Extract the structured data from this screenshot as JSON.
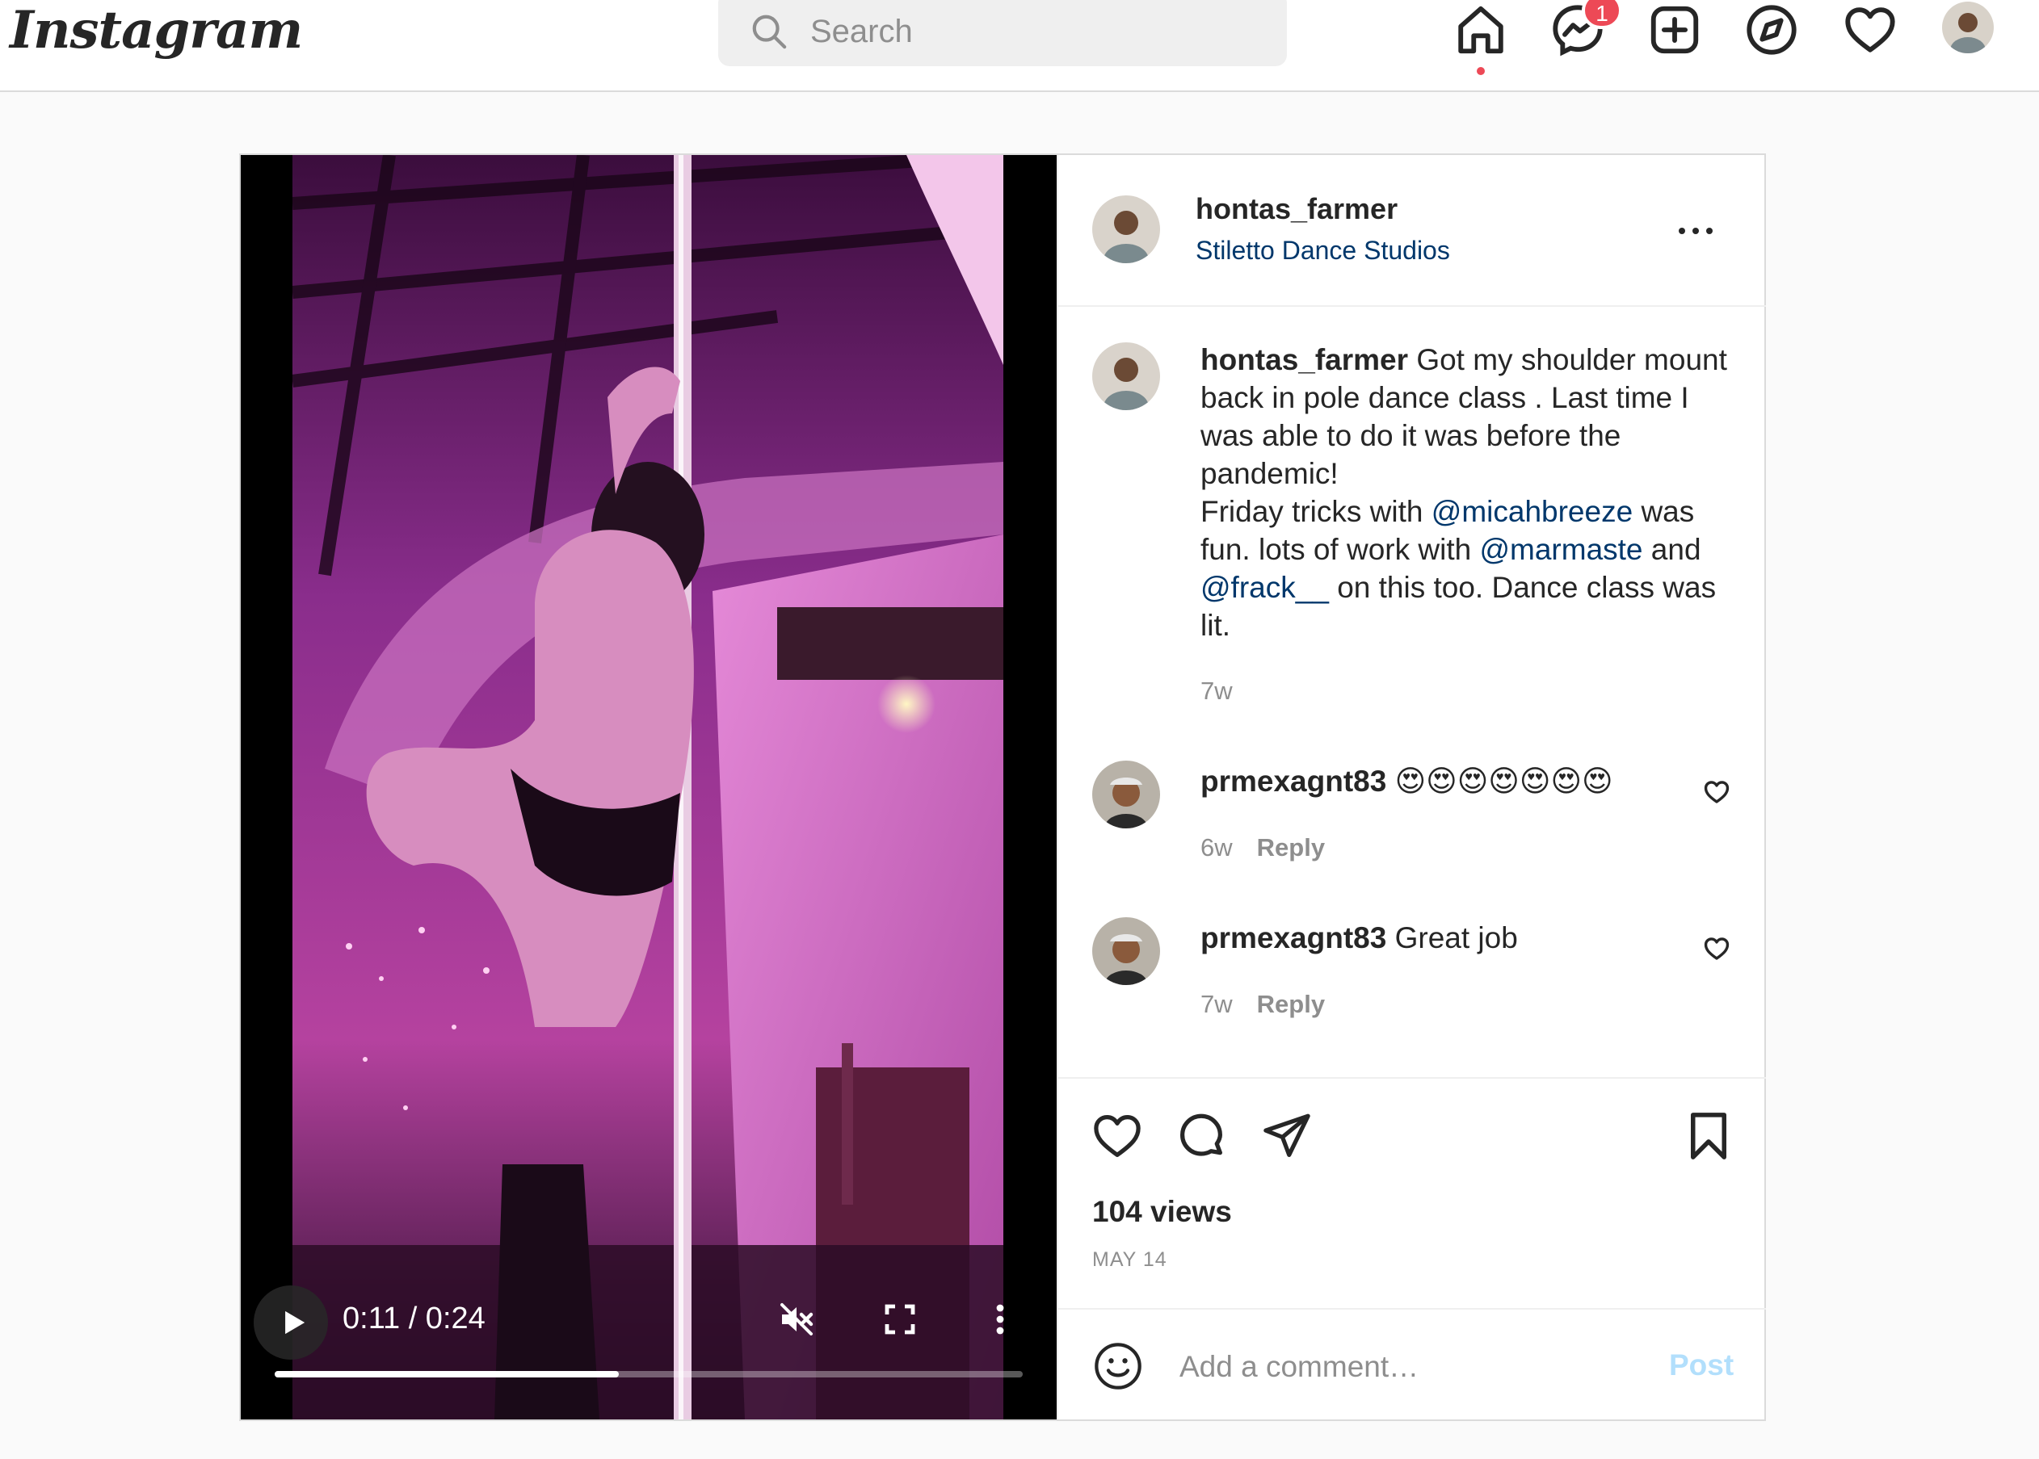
{
  "brand": {
    "logo_text": "Instagram"
  },
  "search": {
    "placeholder": "Search"
  },
  "nav": {
    "icons": [
      "home-icon",
      "messenger-icon",
      "new-post-icon",
      "explore-icon",
      "activity-heart-icon",
      "profile-avatar"
    ],
    "messenger_badge": "1",
    "active": "home",
    "accent_color": "#ed4956"
  },
  "video": {
    "time_display": "0:11 / 0:24",
    "progress_fraction": 0.46,
    "muted": true,
    "controls": [
      "play-icon",
      "mute-icon",
      "fullscreen-icon",
      "more-vert-icon"
    ]
  },
  "post": {
    "username": "hontas_farmer",
    "location": "Stiletto Dance Studios",
    "caption": {
      "username": "hontas_farmer",
      "text_1": "Got my shoulder mount back in pole dance class . Last time I was able to do it was before the pandemic!",
      "text_2": "Friday tricks with",
      "mention_1": "@micahbreeze",
      "text_3": "was fun. lots of work with",
      "mention_2": "@marmaste",
      "text_4": "and",
      "mention_3": "@frack__",
      "text_5": "on this too. Dance class was lit.",
      "age": "7w"
    },
    "comments": [
      {
        "username": "prmexagnt83",
        "text": "😍😍😍😍😍😍😍",
        "age": "6w",
        "reply_label": "Reply"
      },
      {
        "username": "prmexagnt83",
        "text": "Great job",
        "age": "7w",
        "reply_label": "Reply"
      }
    ],
    "views": "104 views",
    "date": "MAY 14",
    "add_comment_placeholder": "Add a comment…",
    "post_button": "Post",
    "link_color": "#00376b",
    "post_button_color": "#b2dffc"
  }
}
